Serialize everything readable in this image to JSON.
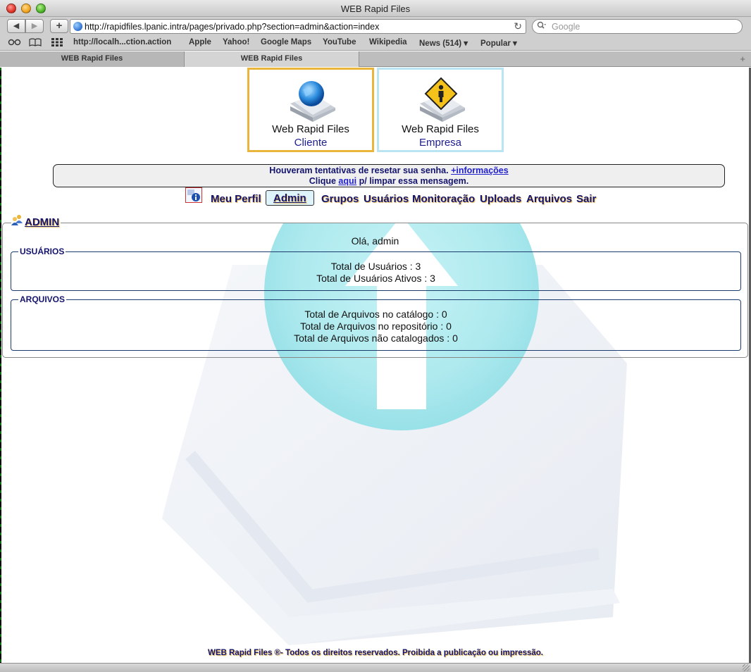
{
  "window": {
    "title": "WEB Rapid Files"
  },
  "toolbar": {
    "back_icon": "◀",
    "forward_icon": "▶",
    "add_icon": "+",
    "url": "http://rapidfiles.lpanic.intra/pages/privado.php?section=admin&action=index",
    "reload_icon": "↻",
    "search_placeholder": "Google",
    "search_icon": "🔍"
  },
  "bookmarks": {
    "reader_icon": "∞",
    "book_icon": "📖",
    "grid_icon": "▦",
    "items": [
      "http://localh...ction.action",
      "Apple",
      "Yahoo!",
      "Google Maps",
      "YouTube",
      "Wikipedia",
      "News (514) ▾",
      "Popular ▾"
    ]
  },
  "tabs": {
    "items": [
      "WEB Rapid Files",
      "WEB Rapid Files"
    ],
    "add_icon": "+"
  },
  "cards": {
    "cliente": {
      "title": "Web Rapid Files",
      "sub": "Cliente"
    },
    "empresa": {
      "title": "Web Rapid Files",
      "sub": "Empresa"
    }
  },
  "alert": {
    "line1_text": "Houveram tentativas de resetar sua senha.",
    "line1_link": "+informações",
    "line2_pre": "Clique",
    "line2_link": "aqui",
    "line2_post": "p/ limpar essa mensagem."
  },
  "menu": {
    "items": [
      "Meu Perfil",
      "Admin",
      "Grupos",
      "Usuários",
      "Monitoração",
      "Uploads",
      "Arquivos",
      "Sair"
    ],
    "active_index": 1
  },
  "admin": {
    "title": "ADMIN",
    "greeting": "Olá, admin",
    "usuarios": {
      "legend": "USUÁRIOS",
      "lines": [
        "Total de Usuários : 3",
        "Total de Usuários Ativos : 3"
      ]
    },
    "arquivos": {
      "legend": "ARQUIVOS",
      "lines": [
        "Total de Arquivos no catálogo : 0",
        "Total de Arquivos no repositório : 0",
        "Total de Arquivos não catalogados : 0"
      ]
    }
  },
  "footer": {
    "text": "WEB Rapid Files ®- Todos os direitos reservados. Proibida a publicação ou impressão."
  },
  "colors": {
    "accent": "#14146e",
    "highlight": "#e6b84c",
    "cliente_border": "#e9b53a",
    "empresa_border": "#b9e5f3"
  }
}
